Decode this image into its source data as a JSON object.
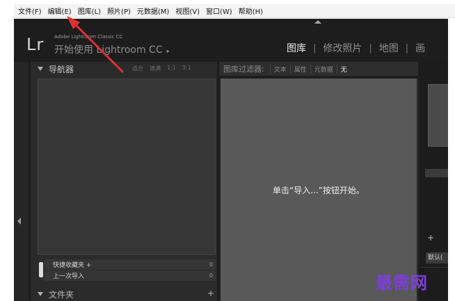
{
  "menubar": {
    "items": [
      "文件(F)",
      "编辑(E)",
      "图库(L)",
      "照片(P)",
      "元数据(M)",
      "视图(V)",
      "窗口(W)",
      "帮助(H)"
    ]
  },
  "identity": {
    "logo": "Lr",
    "brand_small": "Adobe Lightroom Classic CC",
    "start_link": "开始使用 Lightroom CC",
    "start_arrow": "▸"
  },
  "modules": {
    "items": [
      "图库",
      "修改照片",
      "地图",
      "画"
    ],
    "active_index": 0
  },
  "navigator": {
    "title": "导航器",
    "zoom_options": [
      "适合",
      "填满",
      "1:1",
      "3:1"
    ]
  },
  "collections": {
    "quick": {
      "label": "快捷收藏夹 +",
      "count": "0"
    },
    "previous": {
      "label": "上一次导入",
      "count": "0"
    }
  },
  "folders": {
    "title": "文件夹",
    "plus": "+"
  },
  "filter_bar": {
    "label": "图库过滤器:",
    "options": [
      "文本",
      "属性",
      "元数据",
      "无"
    ],
    "active_index": 3
  },
  "grid": {
    "empty_message": "单击“导入...”按钮开始。"
  },
  "right_panel": {
    "plus": "+",
    "default_label": "默认("
  },
  "watermark": "最需网",
  "colors": {
    "annotation_arrow": "#e03030",
    "watermark": "#7b3fd6",
    "app_background": "#1d1d1d"
  },
  "icons": {
    "collapse_top": "triangle-up-icon",
    "collapse_left": "triangle-left-icon",
    "panel_expand": "triangle-down-icon"
  }
}
